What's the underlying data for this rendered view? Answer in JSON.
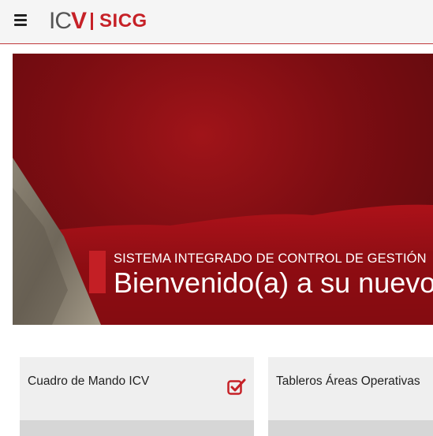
{
  "header": {
    "menu_icon": "hamburger-menu-icon",
    "logo": {
      "brand": "ICV",
      "app": "SICG"
    }
  },
  "banner": {
    "subtitle": "SISTEMA INTEGRADO DE CONTROL DE GESTIÓN",
    "title": "Bienvenido(a) a su nuevo"
  },
  "cards": [
    {
      "title": "Cuadro de Mando ICV",
      "icon": "checkbox-checked-icon"
    },
    {
      "title": "Tableros Áreas Operativas"
    }
  ],
  "colors": {
    "brand_red": "#c62127",
    "header_bg": "#f5f5f5",
    "card_bg": "#efefef"
  }
}
